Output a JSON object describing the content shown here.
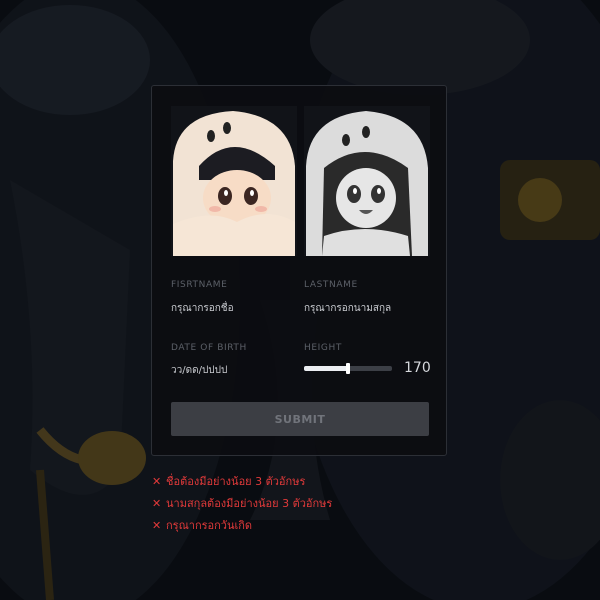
{
  "form": {
    "firstname_label": "FISRTNAME",
    "firstname_placeholder": "กรุณากรอกชื่อ",
    "lastname_label": "LASTNAME",
    "lastname_placeholder": "กรุณากรอกนามสกุล",
    "dob_label": "DATE OF BIRTH",
    "dob_placeholder": "วว/ดด/ปปปป",
    "height_label": "HEIGHT",
    "height_value": "170",
    "height_fraction": 0.5,
    "submit_label": "SUBMIT"
  },
  "portraits": [
    {
      "name": "character-color",
      "style": "color"
    },
    {
      "name": "character-grayscale",
      "style": "grayscale"
    }
  ],
  "errors": [
    {
      "icon": "close-icon",
      "text": "ชื่อต้องมีอย่างน้อย 3 ตัวอักษร"
    },
    {
      "icon": "close-icon",
      "text": "นามสกุลต้องมีอย่างน้อย 3 ตัวอักษร"
    },
    {
      "icon": "close-icon",
      "text": "กรุณากรอกวันเกิด"
    }
  ],
  "colors": {
    "error": "#e23a3a",
    "card_bg": "#0c0d11",
    "submit_bg": "#3c3e44"
  }
}
